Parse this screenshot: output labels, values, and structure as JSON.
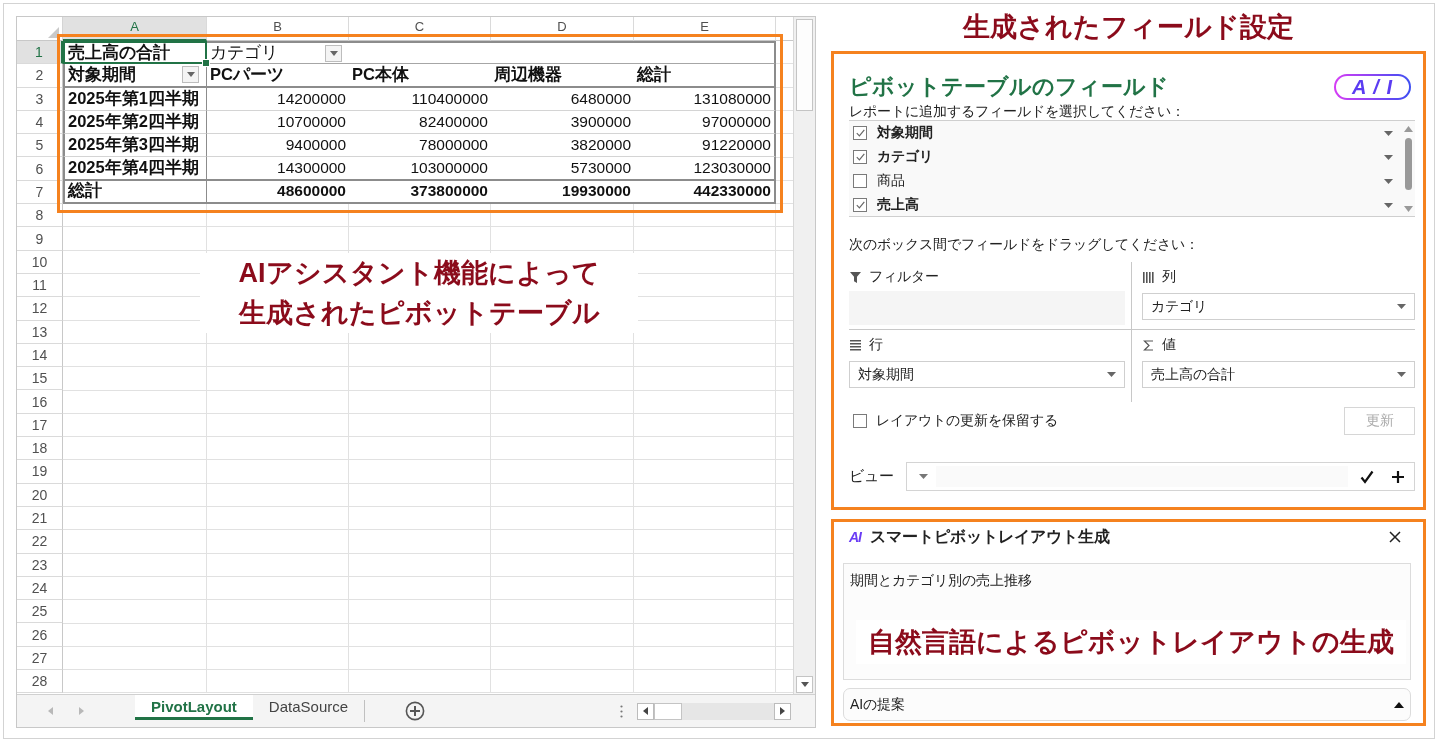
{
  "spreadsheet": {
    "column_headers": [
      {
        "label": "A",
        "selected": true
      },
      {
        "label": "B",
        "selected": false
      },
      {
        "label": "C",
        "selected": false
      },
      {
        "label": "D",
        "selected": false
      },
      {
        "label": "E",
        "selected": false
      }
    ],
    "row_headers": [
      {
        "label": "1",
        "selected": true
      },
      {
        "label": "2",
        "selected": false
      },
      {
        "label": "3",
        "selected": false
      },
      {
        "label": "4",
        "selected": false
      },
      {
        "label": "5",
        "selected": false
      },
      {
        "label": "6",
        "selected": false
      },
      {
        "label": "7",
        "selected": false
      },
      {
        "label": "8",
        "selected": false
      },
      {
        "label": "9",
        "selected": false
      },
      {
        "label": "10",
        "selected": false
      },
      {
        "label": "11",
        "selected": false
      },
      {
        "label": "12",
        "selected": false
      },
      {
        "label": "13",
        "selected": false
      },
      {
        "label": "14",
        "selected": false
      },
      {
        "label": "15",
        "selected": false
      },
      {
        "label": "16",
        "selected": false
      },
      {
        "label": "17",
        "selected": false
      },
      {
        "label": "18",
        "selected": false
      },
      {
        "label": "19",
        "selected": false
      },
      {
        "label": "20",
        "selected": false
      },
      {
        "label": "21",
        "selected": false
      },
      {
        "label": "22",
        "selected": false
      },
      {
        "label": "23",
        "selected": false
      },
      {
        "label": "24",
        "selected": false
      },
      {
        "label": "25",
        "selected": false
      },
      {
        "label": "26",
        "selected": false
      },
      {
        "label": "27",
        "selected": false
      },
      {
        "label": "28",
        "selected": false
      }
    ],
    "pivot": {
      "value_field": "売上高の合計",
      "column_field": "カテゴリ",
      "row_field": "対象期間",
      "column_labels": [
        "PCパーツ",
        "PC本体",
        "周辺機器",
        "総計"
      ],
      "rows": [
        {
          "label": "2025年第1四半期",
          "values": [
            "14200000",
            "110400000",
            "6480000",
            "131080000"
          ]
        },
        {
          "label": "2025年第2四半期",
          "values": [
            "10700000",
            "82400000",
            "3900000",
            "97000000"
          ]
        },
        {
          "label": "2025年第3四半期",
          "values": [
            "9400000",
            "78000000",
            "3820000",
            "91220000"
          ]
        },
        {
          "label": "2025年第4四半期",
          "values": [
            "14300000",
            "103000000",
            "5730000",
            "123030000"
          ]
        }
      ],
      "total": {
        "label": "総計",
        "values": [
          "48600000",
          "373800000",
          "19930000",
          "442330000"
        ]
      }
    },
    "callout": [
      "AIアシスタント機能によって",
      "生成されたピボットテーブル"
    ]
  },
  "sheet_tabs": [
    {
      "label": "PivotLayout",
      "selected": true
    },
    {
      "label": "DataSource",
      "selected": false
    }
  ],
  "field_settings_heading": "生成されたフィールド設定",
  "field_panel": {
    "title": "ピボットテーブルのフィールド",
    "badge": "A / I",
    "choose_label": "レポートに追加するフィールドを選択してください：",
    "fields": [
      {
        "name": "対象期間",
        "checked": true
      },
      {
        "name": "カテゴリ",
        "checked": true
      },
      {
        "name": "商品",
        "checked": false
      },
      {
        "name": "売上高",
        "checked": true
      }
    ],
    "drag_label": "次のボックス間でフィールドをドラッグしてください：",
    "areas": [
      {
        "kind": "filter",
        "label": "フィルター"
      },
      {
        "kind": "columns",
        "label": "列",
        "fields": [
          "カテゴリ"
        ]
      },
      {
        "kind": "rows",
        "label": "行",
        "fields": [
          "対象期間"
        ]
      },
      {
        "kind": "values",
        "label": "値",
        "fields": [
          "売上高の合計"
        ]
      }
    ],
    "defer_update": {
      "label": "レイアウトの更新を保留する",
      "checked": false
    },
    "update_button": {
      "label": "更新",
      "disabled": true
    },
    "view": {
      "label": "ビュー"
    }
  },
  "smart_panel": {
    "logo": "AI",
    "title": "スマートピボットレイアウト生成",
    "prompt": "期間とカテゴリ別の売上推移",
    "callout": "自然言語によるピボットレイアウトの生成",
    "suggestions": "AIの提案"
  }
}
